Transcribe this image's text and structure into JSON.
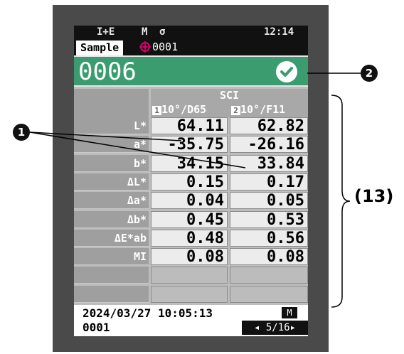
{
  "status": {
    "mode": "I+E",
    "meas_mode": "M",
    "time": "12:14"
  },
  "sample": {
    "tab_label": "Sample",
    "target_number": "0001"
  },
  "record": {
    "name": "0006"
  },
  "table": {
    "header": "SCI",
    "col1": "10°/D65",
    "col2": "10°/F11",
    "col1_badge": "1",
    "col2_badge": "2",
    "rows": [
      {
        "label": "L*",
        "v1": "64.11",
        "v2": "62.82"
      },
      {
        "label": "a*",
        "v1": "-35.75",
        "v2": "-26.16"
      },
      {
        "label": "b*",
        "v1": "34.15",
        "v2": "33.84"
      },
      {
        "label": "ΔL*",
        "v1": "0.15",
        "v2": "0.17"
      },
      {
        "label": "Δa*",
        "v1": "0.04",
        "v2": "0.05"
      },
      {
        "label": "Δb*",
        "v1": "0.45",
        "v2": "0.53"
      },
      {
        "label": "ΔE*ab",
        "v1": "0.48",
        "v2": "0.56"
      },
      {
        "label": "MI",
        "v1": "0.08",
        "v2": "0.08"
      },
      {
        "label": "",
        "v1": "",
        "v2": ""
      },
      {
        "label": "",
        "v1": "",
        "v2": ""
      }
    ]
  },
  "footer": {
    "datetime": "2024/03/27 10:05:13",
    "number": "0001",
    "badge": "M",
    "pager": "◂ 5/16▸"
  },
  "callouts": {
    "one": "1",
    "two": "2",
    "bracket": "(13)"
  }
}
